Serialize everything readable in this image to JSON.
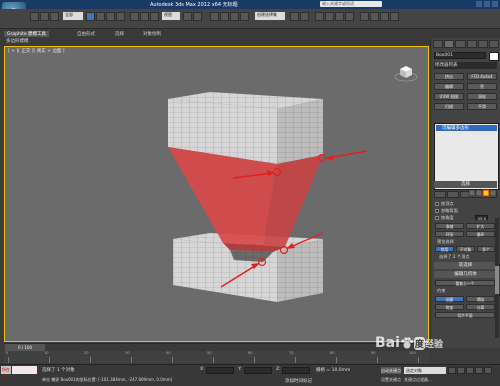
{
  "app": {
    "title": "Autodesk 3ds Max 2012 x64  无标题",
    "logo_text": "3",
    "help_search_placeholder": "键入关键字或短语"
  },
  "toolbar": {
    "selection_filter": "全部",
    "view_dropdown": "视图",
    "selection_set": "创建选择集"
  },
  "ribbon": {
    "tabs": [
      "Graphite 建模工具",
      "自由形式",
      "选择",
      "对象绘制"
    ],
    "active_tab": 0,
    "subtitle": "多边形建模"
  },
  "viewport": {
    "label": "[ + ][ 正交 ][ 真实 + 边面 ]"
  },
  "command_panel": {
    "object_name": "Box001",
    "modifier_list": "修改器列表",
    "mod_buttons": [
      "挤出",
      "FFD 4x4x4",
      "编辑",
      "壳",
      "UVW 贴图",
      "涡轮",
      "扫描",
      "平滑"
    ],
    "stack_item": "可编辑多边形",
    "selection_rollout": "选择",
    "by_vertex": "按顶点",
    "ignore_backfacing": "忽略背面",
    "by_angle": "按角度",
    "by_angle_value": "45.0",
    "shrink": "收缩",
    "grow": "扩大",
    "ring": "环形",
    "loop": "循环",
    "preview_selection": "预览选择",
    "preview_off": "禁用",
    "preview_subobj": "子对象",
    "preview_multi": "多个",
    "selected_count": "选择了 2 个顶点",
    "soft_selection": "软选择",
    "edit_geometry": "编辑几何体",
    "repeat_last": "重复上一个",
    "constraints": "约束",
    "create": "创建",
    "collapse": "塌陷",
    "attach": "附加",
    "detach": "分离",
    "slice_plane": "切片平面"
  },
  "timeslider": {
    "frame": "0 / 100"
  },
  "trackbar": {
    "ticks": [
      "0",
      "10",
      "20",
      "30",
      "40",
      "50",
      "60",
      "70",
      "80",
      "90",
      "100"
    ]
  },
  "status": {
    "listener_label": "所在行:",
    "selection_info": "选择了 1 个对象",
    "prompt": "单击 捕捉 Box001的坐标位置: [-101.384mm, -247.609mm, 0.0mm]",
    "x_label": "X:",
    "x_value": "",
    "y_label": "Y:",
    "z_label": "Z:",
    "grid": "栅格 = 10.0mm",
    "add_time_tag": "添加时间标记",
    "auto_key": "自动关键点",
    "set_key": "设置关键点",
    "selected_dd": "选定对象",
    "key_filters": "关键点过滤器..."
  },
  "watermark": {
    "text_before": "Bai",
    "du": "度",
    "text_after": "经验"
  },
  "colors": {
    "title_bar": "#1a3a66",
    "active_blue": "#3f74b8",
    "viewport_bg": "#6b6b6b",
    "highlight_red": "#e02020",
    "active_border": "#f0c000"
  }
}
